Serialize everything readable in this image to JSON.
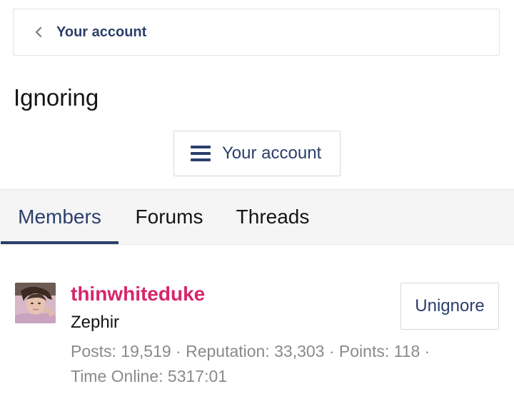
{
  "breadcrumb": {
    "label": "Your account",
    "icon": "chevron-left-icon"
  },
  "page": {
    "title": "Ignoring"
  },
  "menu_button": {
    "label": "Your account",
    "icon": "hamburger-menu-icon"
  },
  "tabs": [
    {
      "label": "Members",
      "active": true
    },
    {
      "label": "Forums",
      "active": false
    },
    {
      "label": "Threads",
      "active": false
    }
  ],
  "members": [
    {
      "username": "thinwhiteduke",
      "user_title": "Zephir",
      "stats_line1": "Posts: 19,519 · Reputation: 33,303 · Points: 118 ·",
      "stats_line2": "Time Online: 5317:01",
      "action_label": "Unignore"
    }
  ],
  "colors": {
    "accent": "#2b3f6b",
    "username": "#d6266b",
    "muted_text": "#8a8a8a",
    "tab_bar_bg": "#f5f5f5"
  }
}
